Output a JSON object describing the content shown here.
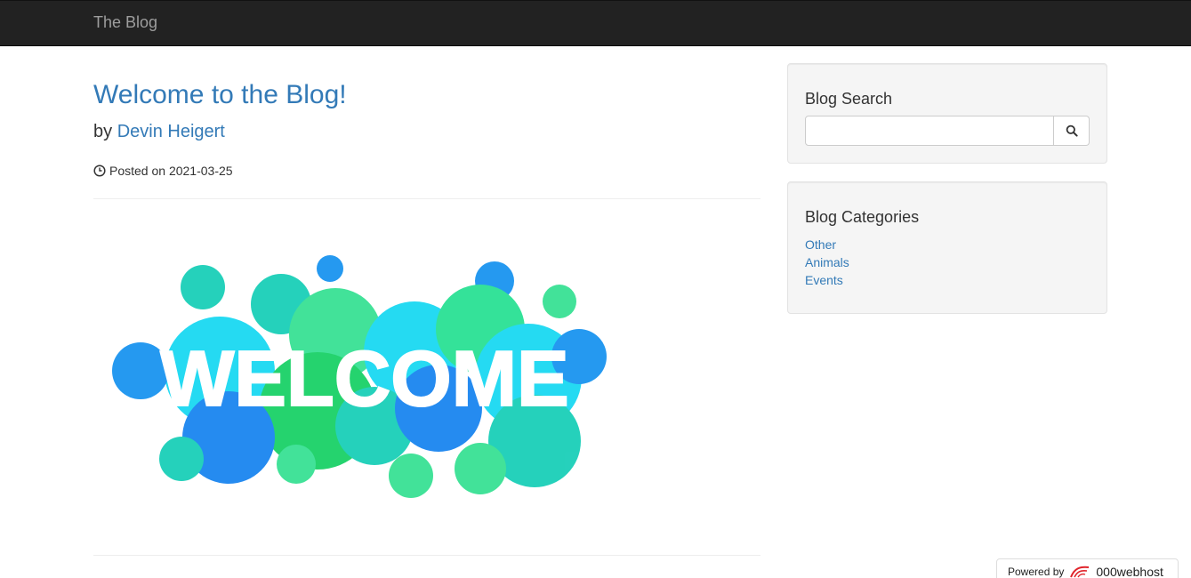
{
  "navbar": {
    "brand": "The Blog"
  },
  "post": {
    "title": "Welcome to the Blog!",
    "by_prefix": "by",
    "author": "Devin Heigert",
    "posted": "Posted on 2021-03-25",
    "image_text": "WELCOME"
  },
  "sidebar": {
    "search": {
      "heading": "Blog Search",
      "input_value": "",
      "placeholder": ""
    },
    "categories": {
      "heading": "Blog Categories",
      "items": [
        {
          "label": "Other"
        },
        {
          "label": "Animals"
        },
        {
          "label": "Events"
        }
      ]
    }
  },
  "footer_badge": {
    "powered_by": "Powered by",
    "host": "000webhost"
  },
  "colors": {
    "link": "#337ab7",
    "navbar": "#222222",
    "well": "#f5f5f5"
  }
}
